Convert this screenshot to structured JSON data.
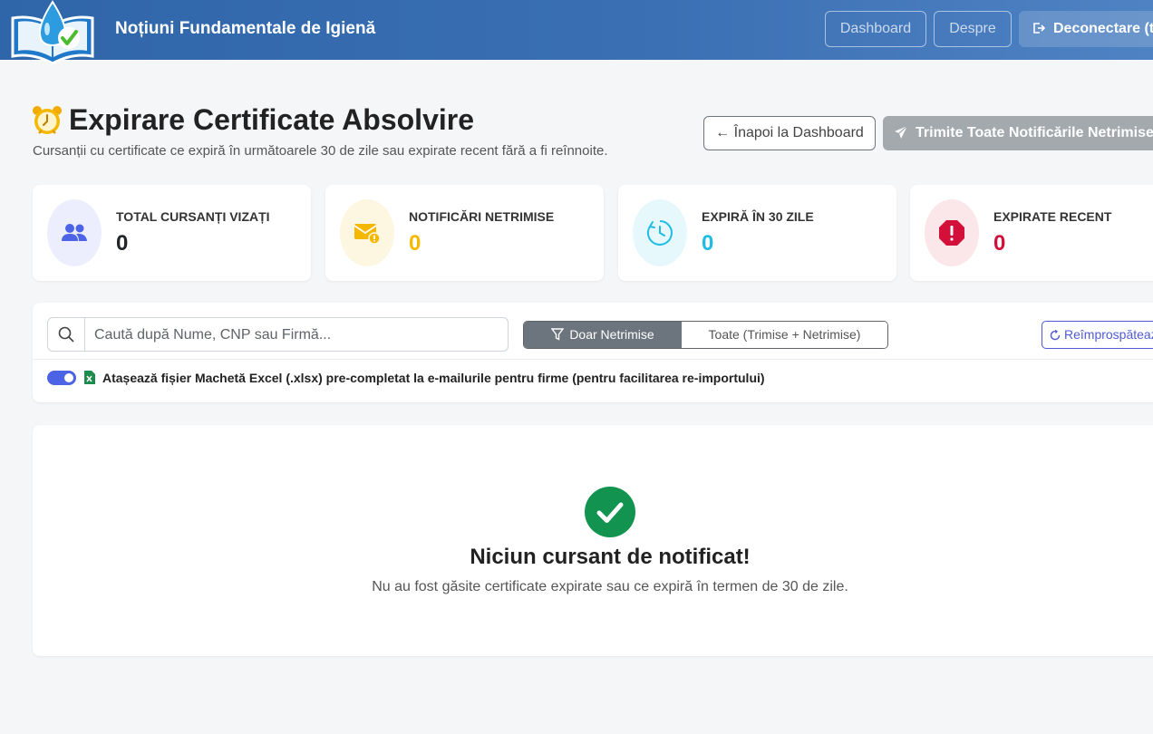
{
  "navbar": {
    "brand": "Noțiuni Fundamentale de Igienă",
    "links": [
      {
        "label": "Dashboard"
      },
      {
        "label": "Despre"
      }
    ],
    "logout_label": "Deconectare (t"
  },
  "header": {
    "title": "Expirare Certificate Absolvire",
    "subtitle": "Cursanții cu certificate ce expiră în următoarele 30 de zile sau expirate recent fără a fi reînnoite.",
    "back_label": "← Înapoi la Dashboard",
    "send_all_label": "Trimite Toate Notificările Netrimise"
  },
  "stats": [
    {
      "label": "TOTAL CURSANȚI VIZAȚI",
      "value": "0",
      "icon": "users-icon",
      "color": "#212529",
      "bg": "#eceefe",
      "icon_color": "#4c63e6"
    },
    {
      "label": "NOTIFICĂRI NETRIMISE",
      "value": "0",
      "icon": "envelope-exclamation-icon",
      "color": "#f5b800",
      "bg": "#fdf6e0",
      "icon_color": "#f5b800"
    },
    {
      "label": "EXPIRĂ ÎN 30 ZILE",
      "value": "0",
      "icon": "clock-icon",
      "color": "#1fbde4",
      "bg": "#e7f8fc",
      "icon_color": "#1fbde4"
    },
    {
      "label": "EXPIRATE RECENT",
      "value": "0",
      "icon": "stop-exclamation-icon",
      "color": "#d3103a",
      "bg": "#fbe6ea",
      "icon_color": "#d3103a"
    }
  ],
  "filters": {
    "search_placeholder": "Caută după Nume, CNP sau Firmă...",
    "toggle_active": "Doar Netrimise",
    "toggle_inactive": "Toate (Trimise + Netrimise)",
    "refresh_label": "Reîmprospătează",
    "attach_excel_label": "Atașează fișier Machetă Excel (.xlsx) pre-completat la e-mailurile pentru firme (pentru facilitarea re-importului)",
    "attach_excel_enabled": true
  },
  "empty_state": {
    "title": "Niciun cursant de notificat!",
    "message": "Nu au fost găsite certificate expirate sau ce expiră în termen de 30 de zile."
  },
  "colors": {
    "navbar": "#3a6fb3",
    "primary": "#4c63e6",
    "success": "#12934f",
    "secondary": "#6c757d"
  }
}
